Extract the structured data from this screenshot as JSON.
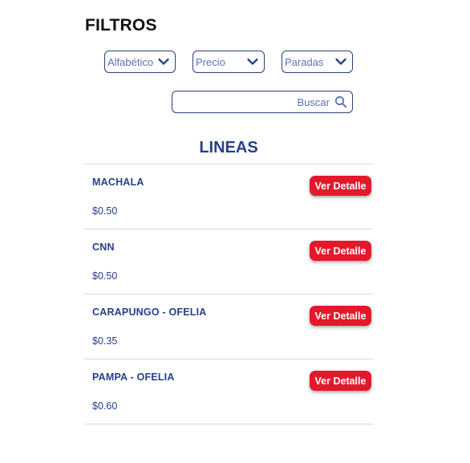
{
  "header": {
    "title": "FILTROS"
  },
  "filters": [
    {
      "label": "Alfabético"
    },
    {
      "label": "Precio"
    },
    {
      "label": "Paradas"
    }
  ],
  "search": {
    "placeholder": "Buscar"
  },
  "section": {
    "title": "LINEAS"
  },
  "lines": [
    {
      "name": "MACHALA",
      "price": "$0.50",
      "button": "Ver Detalle"
    },
    {
      "name": "CNN",
      "price": "$0.50",
      "button": "Ver Detalle"
    },
    {
      "name": "CARAPUNGO - OFELIA",
      "price": "$0.35",
      "button": "Ver Detalle"
    },
    {
      "name": "PAMPA - OFELIA",
      "price": "$0.60",
      "button": "Ver Detalle"
    }
  ],
  "icons": {
    "dropdown": "chevron-down-icon",
    "search": "search-icon"
  },
  "colors": {
    "primary": "#26418a",
    "accent": "#e3192b",
    "placeholder": "#5b73b8"
  }
}
